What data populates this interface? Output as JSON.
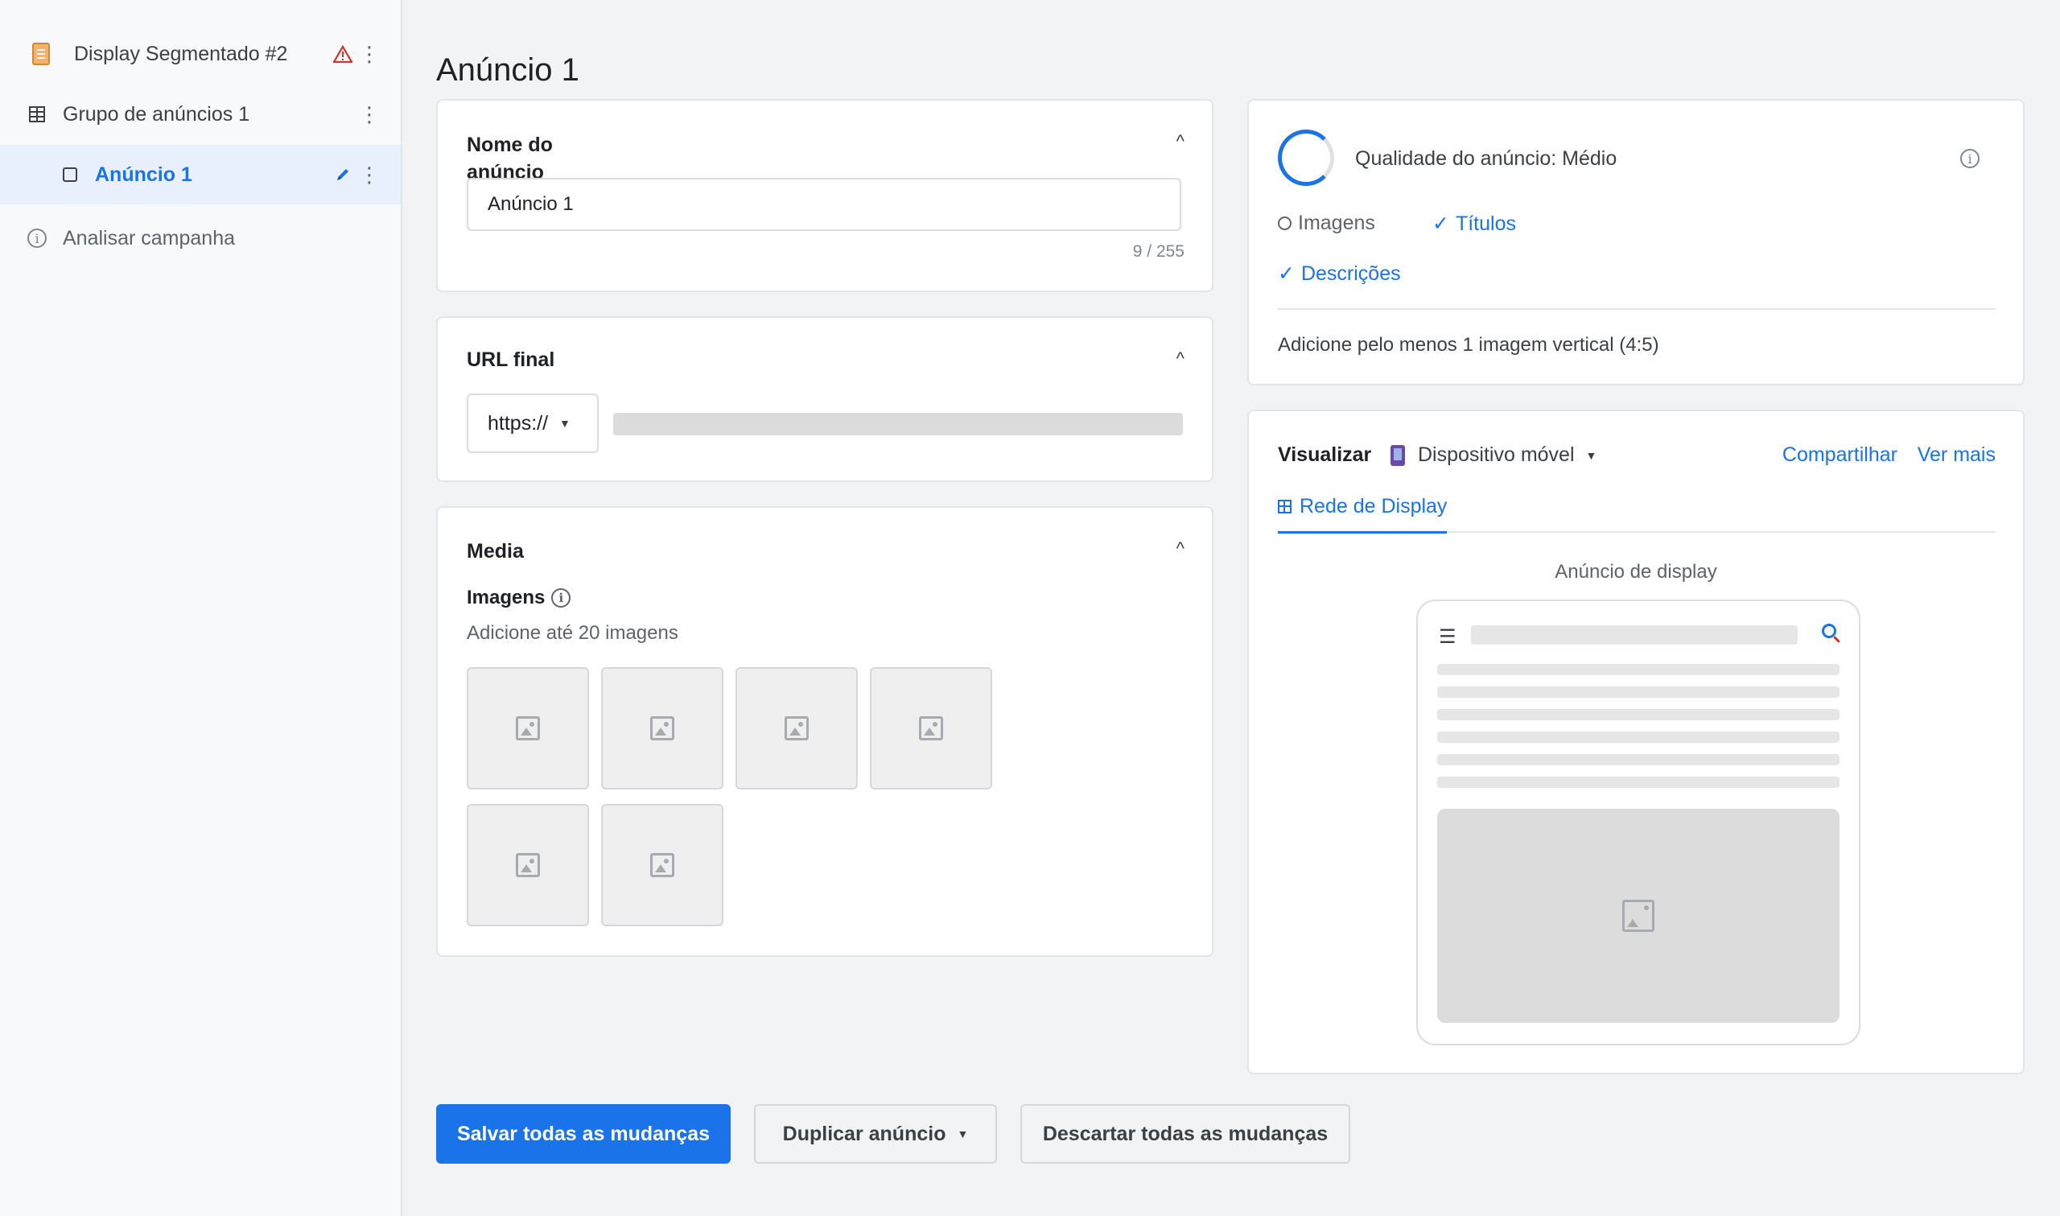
{
  "sidebar": {
    "campaign": {
      "label": "Display Segmentado #2",
      "icon": "notepad-icon",
      "status_icon": "warning-icon"
    },
    "ad_group": {
      "label": "Grupo de anúncios 1",
      "icon": "grid-icon"
    },
    "ad": {
      "label": "Anúncio 1",
      "icon": "square-icon",
      "edit_icon": "pencil-icon"
    },
    "analyze": {
      "label": "Analisar campanha",
      "icon": "info-icon"
    },
    "menu_glyph": "⋮"
  },
  "page": {
    "title": "Anúncio 1"
  },
  "ad_name": {
    "title": "Nome do anúncio",
    "value": "Anúncio 1",
    "counter": "9 / 255"
  },
  "final_url": {
    "title": "URL final",
    "protocol": "https://"
  },
  "media": {
    "title": "Media",
    "images_label": "Imagens",
    "images_hint": "Adicione até 20 imagens"
  },
  "quality": {
    "title": "Qualidade do anúncio: Médio",
    "checks": {
      "images": "Imagens",
      "titles": "Títulos",
      "descriptions": "Descrições"
    },
    "tick": "✓",
    "message": "Adicione pelo menos 1 imagem vertical (4:5)"
  },
  "preview": {
    "label": "Visualizar",
    "device": "Dispositivo móvel",
    "share": "Compartilhar",
    "more": "Ver mais",
    "tab": "Rede de Display",
    "caption": "Anúncio de display",
    "menu_glyph": "☰"
  },
  "actions": {
    "save": "Salvar todas as mudanças",
    "duplicate": "Duplicar anúncio",
    "discard": "Descartar todas as mudanças"
  },
  "symbols": {
    "collapse": "^",
    "caret": "▼",
    "info": "i"
  },
  "colors": {
    "accent": "#1a73e8",
    "warning": "#d93025",
    "selected_bg": "#e8f0fe"
  }
}
